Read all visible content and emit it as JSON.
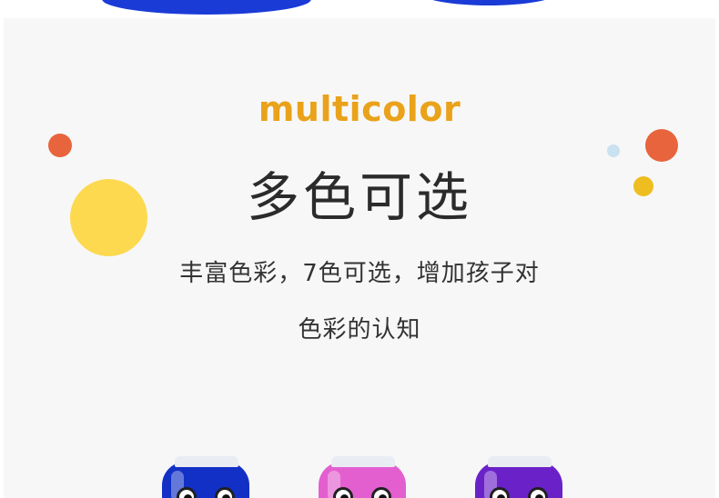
{
  "header": {
    "eyebrow": "multicolor",
    "title": "多色可选"
  },
  "description": {
    "line1": "丰富色彩，7色可选，增加孩子对",
    "line2": "色彩的认知"
  },
  "colors": {
    "eyebrow": "#e9a21a",
    "headline": "#2b2b2b",
    "body_text": "#333333",
    "panel_background": "#f7f7f7",
    "dot_orange": "#e8643c",
    "dot_yellow": "#fcd94f",
    "dot_blue": "#c9e1f0"
  },
  "products": [
    {
      "name": "blue stepping stilt",
      "color": "#1230c6"
    },
    {
      "name": "pink stepping stilt",
      "color": "#e35fd0"
    },
    {
      "name": "purple stepping stilt",
      "color": "#6a22c8"
    }
  ]
}
